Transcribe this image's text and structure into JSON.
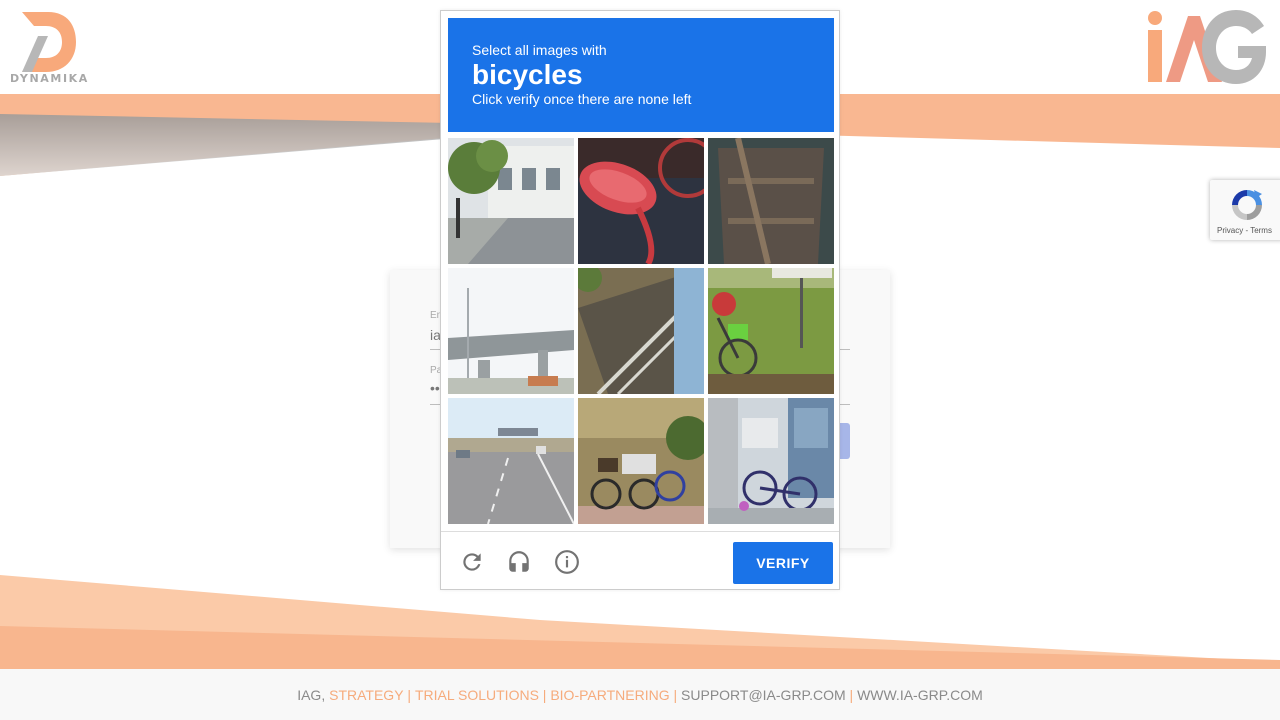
{
  "header": {
    "left_logo_text": "DYNAMIKA",
    "right_logo_text": "iAG"
  },
  "login": {
    "email_label": "En",
    "email_value": "ia",
    "password_label": "Pa",
    "password_value": "••"
  },
  "captcha": {
    "instruction": "Select all images with",
    "target": "bicycles",
    "sub_instruction": "Click verify once there are none left",
    "verify_label": "VERIFY",
    "tiles": [
      {
        "name": "tile-street-building"
      },
      {
        "name": "tile-red-bike-seat"
      },
      {
        "name": "tile-wooden-boat"
      },
      {
        "name": "tile-overpass"
      },
      {
        "name": "tile-staircase"
      },
      {
        "name": "tile-bicycle-on-grass"
      },
      {
        "name": "tile-highway"
      },
      {
        "name": "tile-parked-bicycles"
      },
      {
        "name": "tile-bicycle-by-building"
      }
    ],
    "icons": [
      "reload-icon",
      "audio-icon",
      "info-icon"
    ],
    "accent_color": "#1a73e8"
  },
  "recaptcha_badge": {
    "text": "Privacy - Terms"
  },
  "footer": {
    "prefix": "IAG, ",
    "strategy": "STRATEGY",
    "sep1": " | ",
    "trial": "TRIAL SOLUTIONS",
    "sep2": " | ",
    "bio": "BIO-PARTNERING",
    "sep3": " | ",
    "email": "SUPPORT@IA-GRP.COM",
    "sep4": " | ",
    "website": "WWW.IA-GRP.COM"
  },
  "colors": {
    "brand_orange": "#f6ab7c",
    "brand_gray": "#b5b5b5"
  }
}
